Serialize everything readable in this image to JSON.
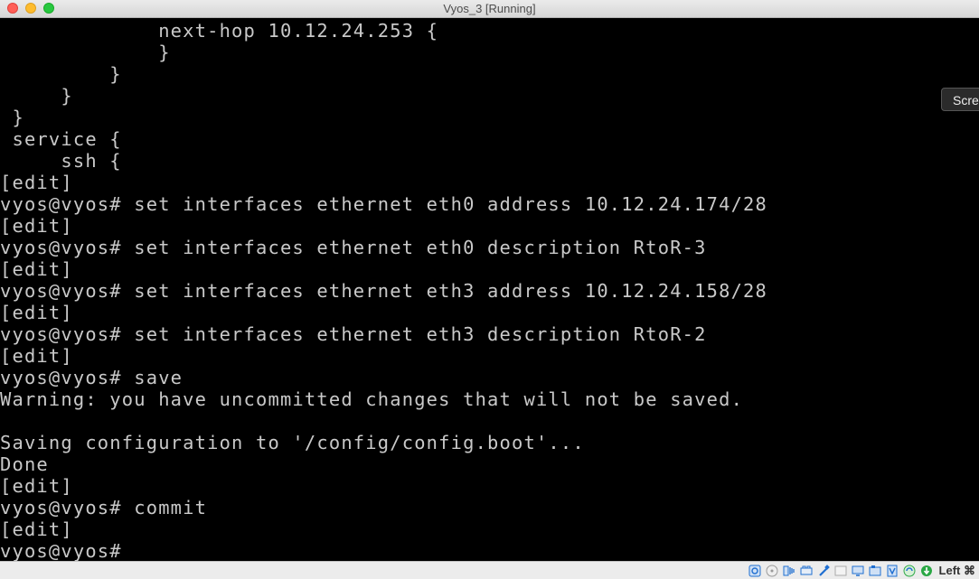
{
  "window": {
    "title": "Vyos_3 [Running]"
  },
  "terminal": {
    "lines": [
      "             next-hop 10.12.24.253 {",
      "             }",
      "         }",
      "     }",
      " }",
      " service {",
      "     ssh {",
      "[edit]",
      "vyos@vyos# set interfaces ethernet eth0 address 10.12.24.174/28",
      "[edit]",
      "vyos@vyos# set interfaces ethernet eth0 description RtoR-3",
      "[edit]",
      "vyos@vyos# set interfaces ethernet eth3 address 10.12.24.158/28",
      "[edit]",
      "vyos@vyos# set interfaces ethernet eth3 description RtoR-2",
      "[edit]",
      "vyos@vyos# save",
      "Warning: you have uncommitted changes that will not be saved.",
      "",
      "Saving configuration to '/config/config.boot'...",
      "Done",
      "[edit]",
      "vyos@vyos# commit",
      "[edit]",
      "vyos@vyos#"
    ]
  },
  "tooltip": {
    "text": "Scre"
  },
  "statusbar": {
    "icons": [
      "hard-disk-icon",
      "optical-drive-icon",
      "audio-icon",
      "network-icon",
      "usb-icon",
      "shared-folder-icon",
      "display-icon",
      "video-capture-icon",
      "cpu-virtualization-icon",
      "mouse-integration-icon",
      "keyboard-capture-icon"
    ],
    "host_key": "Left ⌘",
    "colors": {
      "accent": "#1f6fd1",
      "green": "#2aa845"
    }
  }
}
